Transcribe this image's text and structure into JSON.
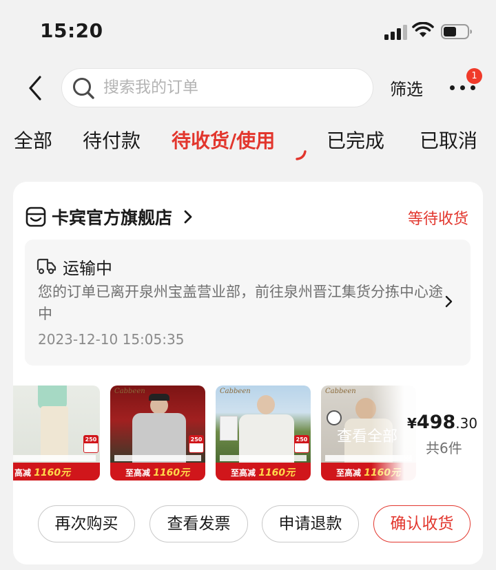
{
  "status_bar": {
    "time": "15:20"
  },
  "search": {
    "placeholder": "搜索我的订单",
    "filter_label": "筛选",
    "more_badge": "1"
  },
  "tabs": [
    {
      "label": "全部"
    },
    {
      "label": "待付款"
    },
    {
      "label": "待收货/使用",
      "active": true
    },
    {
      "label": "已完成"
    },
    {
      "label": "已取消"
    }
  ],
  "order": {
    "store_name": "卡宾官方旗舰店",
    "status": "等待收货",
    "logistics": {
      "status": "运输中",
      "description": "您的订单已离开泉州宝盖营业部，前往泉州晋江集货分拣中心途中",
      "time": "2023-12-10 15:05:35"
    },
    "products": [
      {
        "name": "product-1",
        "price_tag": "250",
        "promo_prefix": "高减",
        "promo_amount": "1160元"
      },
      {
        "name": "product-2",
        "brand": "Cabbeen",
        "price_tag": "250",
        "promo_prefix": "至高减",
        "promo_amount": "1160元"
      },
      {
        "name": "product-3",
        "brand": "Cabbeen",
        "price_tag": "250",
        "promo_prefix": "至高减",
        "promo_amount": "1160元"
      },
      {
        "name": "product-4",
        "brand": "Cabbeen",
        "promo_prefix": "至高减",
        "promo_amount": "1160元"
      }
    ],
    "view_all_label": "查看全部",
    "price": {
      "currency": "¥",
      "integer": "498",
      "decimal": ".30"
    },
    "item_count": "共6件",
    "actions": {
      "buy_again": "再次购买",
      "view_invoice": "查看发票",
      "request_refund": "申请退款",
      "confirm_receipt": "确认收货"
    }
  },
  "colors": {
    "accent": "#e2362d",
    "promo_strip": "#d0161b",
    "page_bg": "#f2f2f2"
  }
}
